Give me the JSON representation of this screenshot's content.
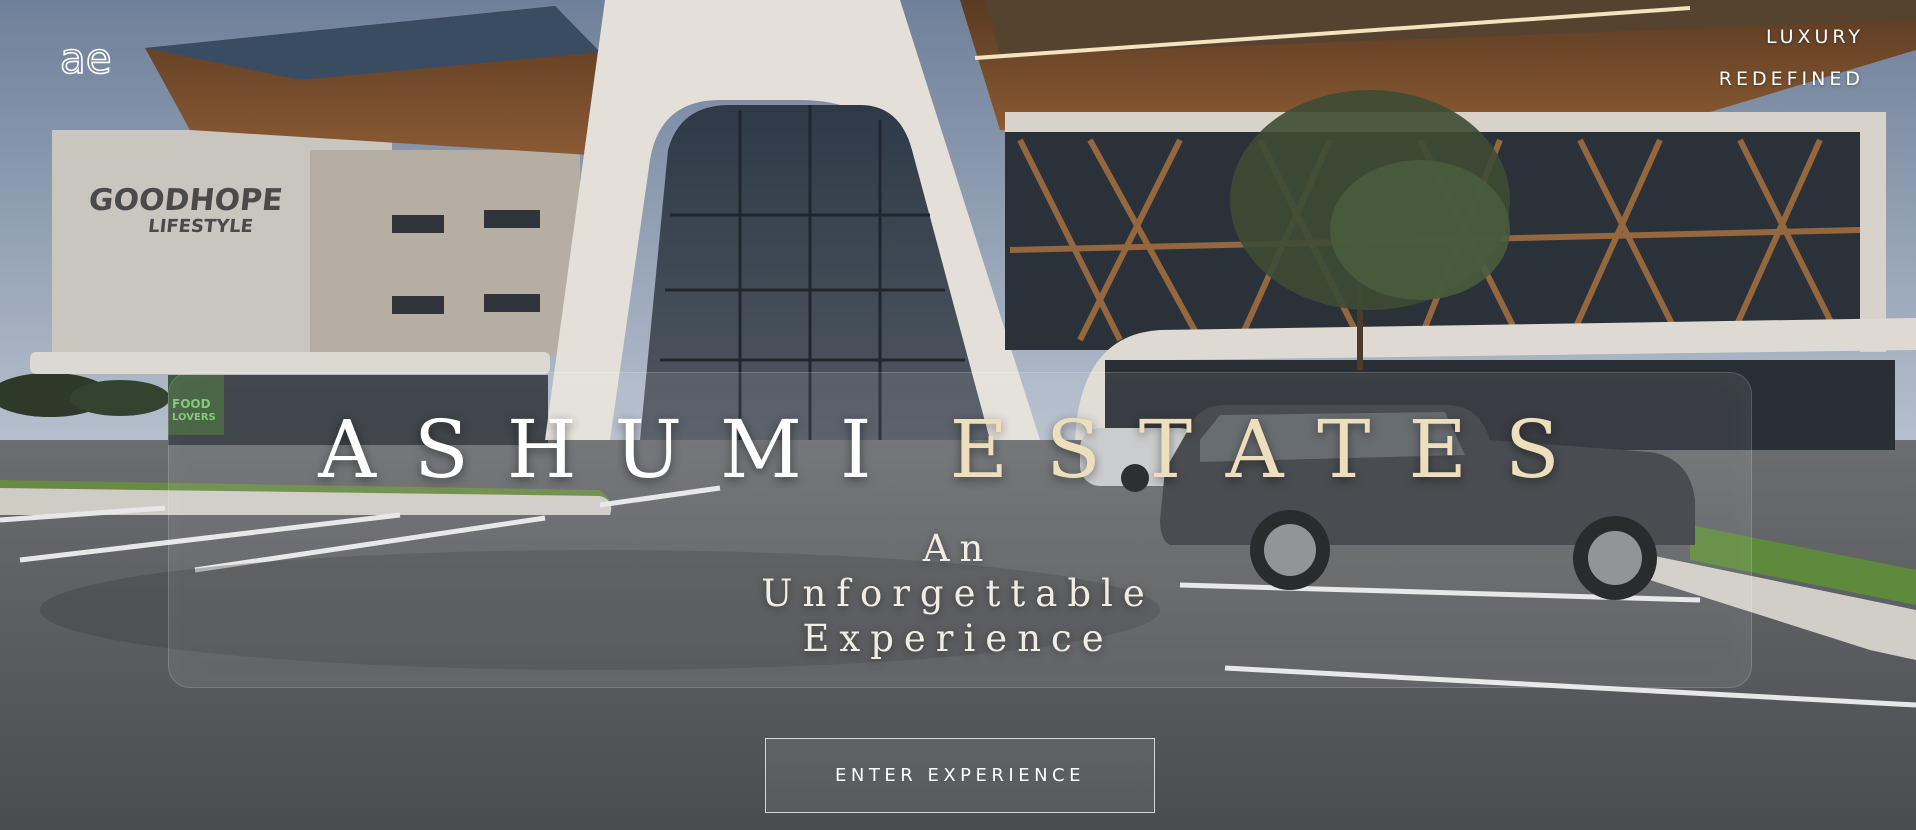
{
  "brand": {
    "logo_text": "ae",
    "tagline_line1": "LUXURY",
    "tagline_line2": "REDEFINED"
  },
  "hero": {
    "title_word1": "ASHUMI",
    "title_word2": "ESTATES",
    "subtitle_line1": "An",
    "subtitle_line2": "Unforgettable",
    "subtitle_line3": "Experience",
    "cta_label": "ENTER EXPERIENCE"
  },
  "background": {
    "building_sign_line1": "GOODHOPE",
    "building_sign_line2": "LIFESTYLE",
    "store_sign_line1": "FOOD",
    "store_sign_line2": "LOVERS"
  },
  "colors": {
    "title_primary": "#ffffff",
    "title_accent": "#eedfbc",
    "sky": "#7e8fa6",
    "asphalt": "#56585c"
  }
}
